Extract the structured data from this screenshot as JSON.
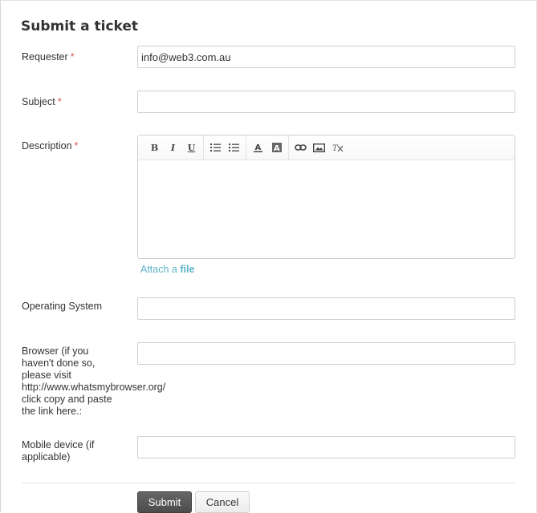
{
  "form": {
    "title": "Submit a ticket",
    "required_mark": "*",
    "requester": {
      "label": "Requester",
      "value": "info@web3.com.au",
      "required": true
    },
    "subject": {
      "label": "Subject",
      "value": "",
      "required": true
    },
    "description": {
      "label": "Description",
      "value": "",
      "required": true
    },
    "toolbar": {
      "bold": "B",
      "italic": "I",
      "underline": "U",
      "icons": [
        "bold-icon",
        "italic-icon",
        "underline-icon",
        "bullet-list-icon",
        "numbered-list-icon",
        "text-color-icon",
        "background-color-icon",
        "link-icon",
        "image-icon",
        "clear-format-icon"
      ]
    },
    "attach": {
      "prefix": "Attach a",
      "link": "file"
    },
    "operating_system": {
      "label": "Operating System",
      "value": ""
    },
    "browser": {
      "label_lines": [
        "Browser (if you",
        "haven't done so,",
        "please visit",
        "http://www.whatsmybrowser.org/",
        "click copy and paste",
        "the link here.:"
      ],
      "value": ""
    },
    "mobile_device": {
      "label_lines": [
        "Mobile device (if",
        "applicable)"
      ],
      "value": ""
    },
    "buttons": {
      "submit": "Submit",
      "cancel": "Cancel"
    }
  }
}
